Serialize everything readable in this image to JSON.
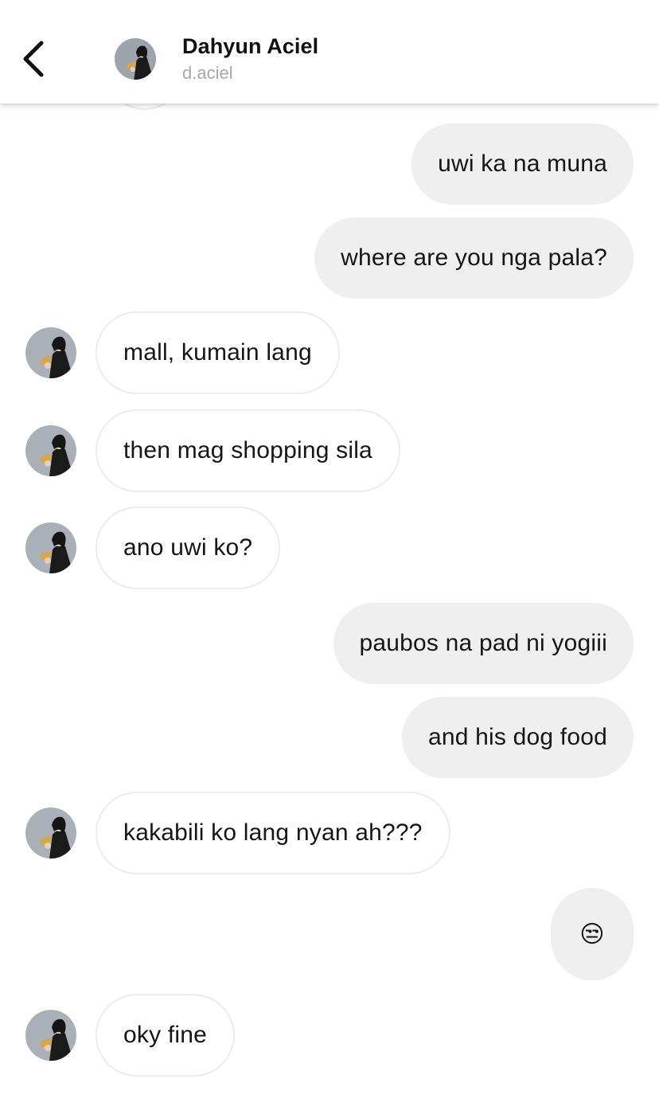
{
  "header": {
    "back_icon": "chevron-left-icon",
    "name": "Dahyun Aciel",
    "handle": "d.aciel"
  },
  "messages": [
    {
      "from": "me",
      "text": "uwi ka na muna"
    },
    {
      "from": "me",
      "text": "where are you nga pala?"
    },
    {
      "from": "them",
      "text": "mall, kumain lang"
    },
    {
      "from": "them",
      "text": "then mag shopping sila"
    },
    {
      "from": "them",
      "text": "ano uwi ko?"
    },
    {
      "from": "me",
      "text": "paubos na pad ni yogiii"
    },
    {
      "from": "me",
      "text": "and his dog food"
    },
    {
      "from": "them",
      "text": "kakabili ko lang nyan ah???"
    },
    {
      "from": "me",
      "text": "😒"
    },
    {
      "from": "them",
      "text": "oky fine"
    }
  ],
  "colors": {
    "sent_bubble": "#efefef",
    "received_bubble_border": "#ececec",
    "handle_text": "#a8a8a8"
  }
}
